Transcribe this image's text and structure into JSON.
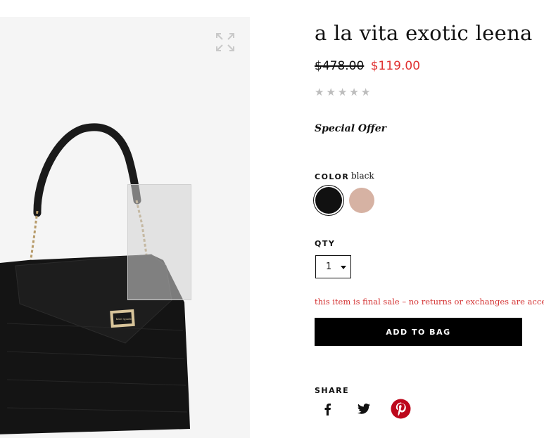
{
  "product": {
    "title": "a la vita exotic leena",
    "price_original": "$478.00",
    "price_sale": "$119.00",
    "rating_stars": 0,
    "rating_max": 5,
    "special_offer": "Special Offer",
    "final_sale_notice": "this item is final sale – no returns or exchanges are accepted"
  },
  "color": {
    "label": "COLOR",
    "selected": "black",
    "options": [
      {
        "name": "black",
        "hex": "#111111"
      },
      {
        "name": "blush",
        "hex": "#d6b2a3"
      }
    ]
  },
  "qty": {
    "label": "QTY",
    "value": "1"
  },
  "cta": {
    "add_to_bag": "ADD TO BAG"
  },
  "share": {
    "label": "SHARE",
    "icons": [
      "facebook-icon",
      "twitter-icon",
      "pinterest-icon"
    ]
  },
  "colors": {
    "sale_price": "#e03232",
    "notice": "#d43333",
    "button_bg": "#000000",
    "pinterest": "#bd081c"
  },
  "image": {
    "icon": "expand-icon",
    "brand_plate": "kate spade"
  }
}
